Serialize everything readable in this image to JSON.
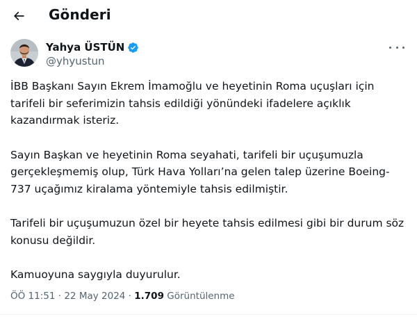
{
  "header": {
    "title": "Gönderi"
  },
  "author": {
    "name": "Yahya ÜSTÜN",
    "handle": "@yhyustun"
  },
  "tweet": {
    "paragraphs": [
      "İBB Başkanı Sayın Ekrem İmamoğlu ve heyetinin Roma uçuşları için tarifeli bir seferimizin tahsis edildiği yönündeki ifadelere açıklık kazandırmak isteriz.",
      "Sayın Başkan ve heyetinin Roma seyahati, tarifeli bir uçuşumuzla gerçekleşmemiş olup, Türk Hava Yolları’na gelen talep üzerine Boeing-737 uçağımız kiralama yöntemiyle tahsis edilmiştir.",
      "Tarifeli bir uçuşumuzun özel bir heyete tahsis edilmesi gibi bir durum söz konusu değildir.",
      "Kamuoyuna saygıyla duyurulur."
    ]
  },
  "meta": {
    "time": "ÖÖ 11:51",
    "separator": "·",
    "date": "22 May 2024",
    "views_count": "1.709",
    "views_label": "Görüntülenme"
  },
  "icons": {
    "back": "arrow-left-icon",
    "verified": "verified-badge-icon",
    "more": "more-horizontal-icon"
  },
  "colors": {
    "text": "#0f1419",
    "secondary": "#536471",
    "verified": "#1d9bf0"
  }
}
